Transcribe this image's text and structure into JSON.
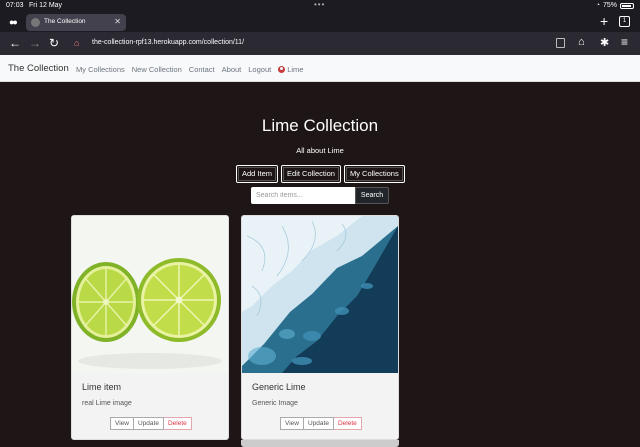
{
  "status_bar": {
    "time": "07:03",
    "date": "Fri 12 May",
    "battery": "75%"
  },
  "browser": {
    "tab_title": "The Collection",
    "tab_count": "1",
    "url": "the-collection-rpf13.herokuapp.com/collection/11/"
  },
  "navbar": {
    "brand": "The Collection",
    "links": [
      "My Collections",
      "New Collection",
      "Contact",
      "About",
      "Logout"
    ],
    "user": "Lime"
  },
  "page": {
    "title": "Lime Collection",
    "subtitle": "All about Lime",
    "actions": [
      "Add Item",
      "Edit Collection",
      "My Collections"
    ],
    "search_placeholder": "Search items...",
    "search_button": "Search"
  },
  "items": [
    {
      "title": "Lime item",
      "description": "real Lime image",
      "image": "lime-slices"
    },
    {
      "title": "Generic Lime",
      "description": "Generic Image",
      "image": "satellite-coast"
    }
  ],
  "item_buttons": {
    "view": "View",
    "update": "Update",
    "delete": "Delete"
  },
  "colors": {
    "page_bg": "#1d1516",
    "navbar_bg": "#f8f9fa",
    "danger": "#dc3545"
  }
}
